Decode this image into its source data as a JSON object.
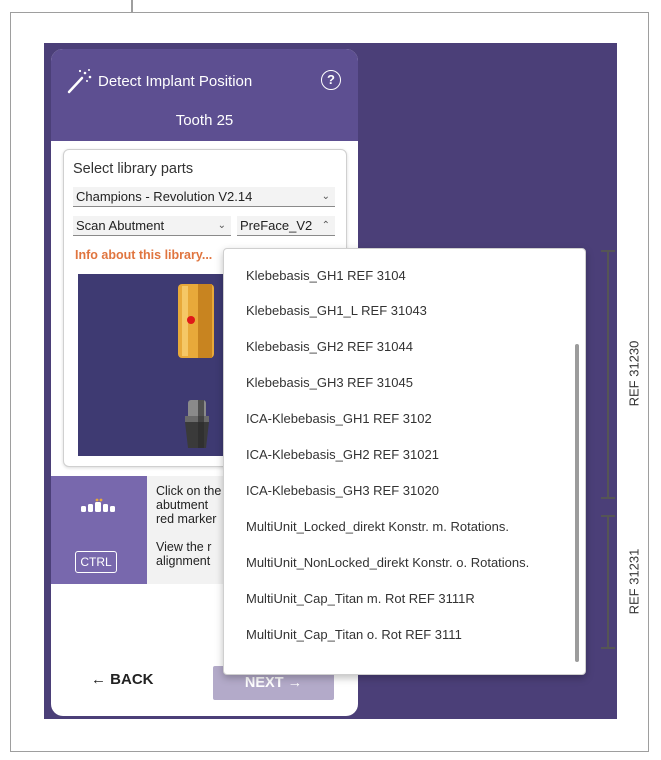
{
  "panel": {
    "title": "Detect Implant Position",
    "subtitle": "Tooth 25",
    "library_section_title": "Select library parts",
    "library_select": "Champions - Revolution V2.14",
    "type_select": "Scan Abutment",
    "variant_select": "PreFace_V2",
    "info_link": "Info about this library...",
    "help": {
      "text_1": "Click on the\nabutment\nred marker",
      "text_2": "View the r\nalignment",
      "ctrl_label": "CTRL"
    },
    "back_label": "← BACK",
    "next_label": "NEXT →"
  },
  "dropdown": {
    "items": [
      "Klebebasis_GH1 REF 3104",
      "Klebebasis_GH1_L REF 31043",
      "Klebebasis_GH2 REF 31044",
      "Klebebasis_GH3 REF 31045",
      "ICA-Klebebasis_GH1 REF 3102",
      "ICA-Klebebasis_GH2 REF 31021",
      "ICA-Klebebasis_GH3 REF 31020",
      "MultiUnit_Locked_direkt Konstr. m. Rotations.",
      "MultiUnit_NonLocked_direkt Konstr. o. Rotations.",
      "MultiUnit_Cap_Titan m. Rot REF 3111R",
      "MultiUnit_Cap_Titan o. Rot REF 3111"
    ]
  },
  "annotations": {
    "bracket_1": "REF 31230",
    "bracket_2": "REF 31231"
  },
  "icons": {
    "header": "magic-wand-icon",
    "help": "help-icon",
    "teeth": "teeth-icon"
  },
  "colors": {
    "background_purple": "#4b3f78",
    "header_purple": "#5d4f91",
    "sidebar_purple": "#7868ad",
    "info_orange": "#e0753f",
    "implant_yellow": "#e8a93a",
    "marker_red": "#e01818"
  }
}
